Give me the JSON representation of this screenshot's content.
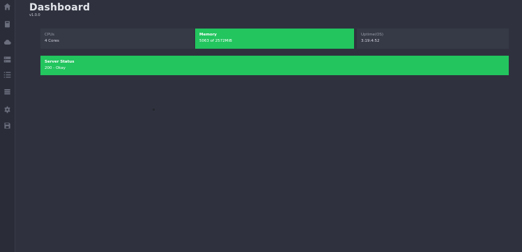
{
  "header": {
    "title": "Dashboard",
    "version": "v1.0.0"
  },
  "sidebar": {
    "items": [
      {
        "icon": "home-icon"
      },
      {
        "icon": "database-icon"
      },
      {
        "icon": "cloud-icon"
      },
      {
        "icon": "server-icon"
      },
      {
        "icon": "list-icon"
      },
      {
        "icon": "storage-icon"
      },
      {
        "icon": "gear-icon"
      },
      {
        "icon": "save-icon"
      }
    ]
  },
  "stats": {
    "cpus": {
      "label": "CPUs",
      "value": "4 Cores"
    },
    "memory": {
      "label": "Memory",
      "value": "5063 of 2572MiB"
    },
    "uptime": {
      "label": "Uptime(OS)",
      "value": "3:19:4:52"
    }
  },
  "server_status": {
    "label": "Server Status",
    "value": "200 - Okay"
  },
  "colors": {
    "background": "#2f323e",
    "sidebar": "#2a2d38",
    "card": "#363946",
    "accent_green": "#22c55e"
  }
}
